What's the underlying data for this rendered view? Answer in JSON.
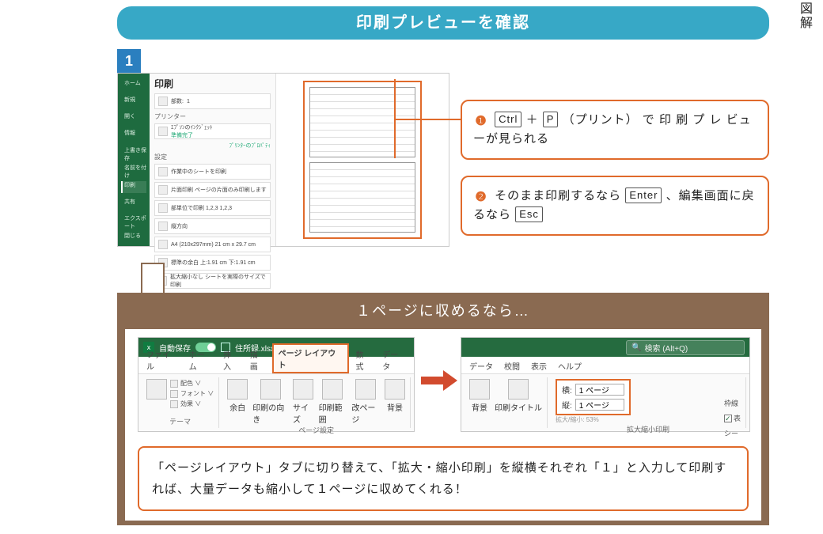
{
  "corner_label": "図解",
  "title_bar": "印刷プレビューを確認",
  "step_badge": "1",
  "callout1": {
    "num": "❶",
    "key1": "Ctrl",
    "plus": "＋",
    "key2": "P",
    "paren": "（プリント）",
    "tail": "で 印 刷 プ レ ビューが見られる"
  },
  "callout2": {
    "num": "❷",
    "lead": "そのまま印刷するなら",
    "key1": "Enter",
    "mid": "、編集画面に戻るなら",
    "key2": "Esc"
  },
  "excel_print": {
    "heading": "印刷",
    "copies_label": "部数:",
    "copies_value": "1",
    "printer_label": "プリンター",
    "printer_name": "ｴﾌﾟｿﾝのｲﾝｸｼﾞｪｯﾄ",
    "printer_status": "準備完了",
    "printer_props": "ﾌﾟﾘﾝﾀｰのﾌﾟﾛﾊﾟﾃｨ",
    "settings_label": "設定",
    "settings": [
      "作業中のシートを印刷",
      "片面印刷 ページの片面のみ印刷します",
      "部単位で印刷 1,2,3  1,2,3",
      "縦方向",
      "A4 (210x297mm) 21 cm x 29.7 cm",
      "標準の余白 上:1.91 cm 下:1.91 cm",
      "拡大縮小なし シートを実際のサイズで印刷"
    ],
    "nav": [
      "ホーム",
      "新規",
      "開く",
      "情報",
      "上書き保存",
      "名前を付け",
      "印刷",
      "共有",
      "エクスポート",
      "閉じる"
    ]
  },
  "panel": {
    "title": "１ページに収めるなら…",
    "ribbon_left": {
      "titlebar_autosave": "自動保存",
      "titlebar_toggle": "オン",
      "titlebar_filename": "住所録.xlsx • 保存済み ∨",
      "tabs": [
        "ファイル",
        "ホーム",
        "挿入",
        "描画",
        "ページ レイアウト",
        "数式",
        "データ"
      ],
      "active_tab_index": 4,
      "group_theme": {
        "label": "テーマ",
        "lines": [
          "配色 ∨",
          "フォント ∨",
          "効果 ∨"
        ]
      },
      "group_pagesetup": {
        "label": "ページ設定",
        "items": [
          "余白",
          "印刷の向き",
          "サイズ",
          "印刷範囲",
          "改ページ",
          "背景"
        ]
      }
    },
    "ribbon_right": {
      "search_placeholder": "検索 (Alt+Q)",
      "tabs": [
        "データ",
        "校閲",
        "表示",
        "ヘルプ"
      ],
      "group_pagesetup": {
        "items": [
          "背景",
          "印刷タイトル"
        ]
      },
      "group_scale": {
        "label": "拡大縮小印刷",
        "width_label": "横:",
        "width_value": "1 ページ",
        "height_label": "縦:",
        "height_value": "1 ページ",
        "scale_label": "拡大/縮小:",
        "scale_value": "53%"
      },
      "group_sheet": {
        "gridlines_label": "枠線",
        "view_label": "表",
        "sheet_label": "シー"
      }
    },
    "explain": "「ページレイアウト」タブに切り替えて、「拡大・縮小印刷」を縦横それぞれ「１」と入力して印刷すれば、大量データも縮小して１ページに収めてくれる！"
  }
}
